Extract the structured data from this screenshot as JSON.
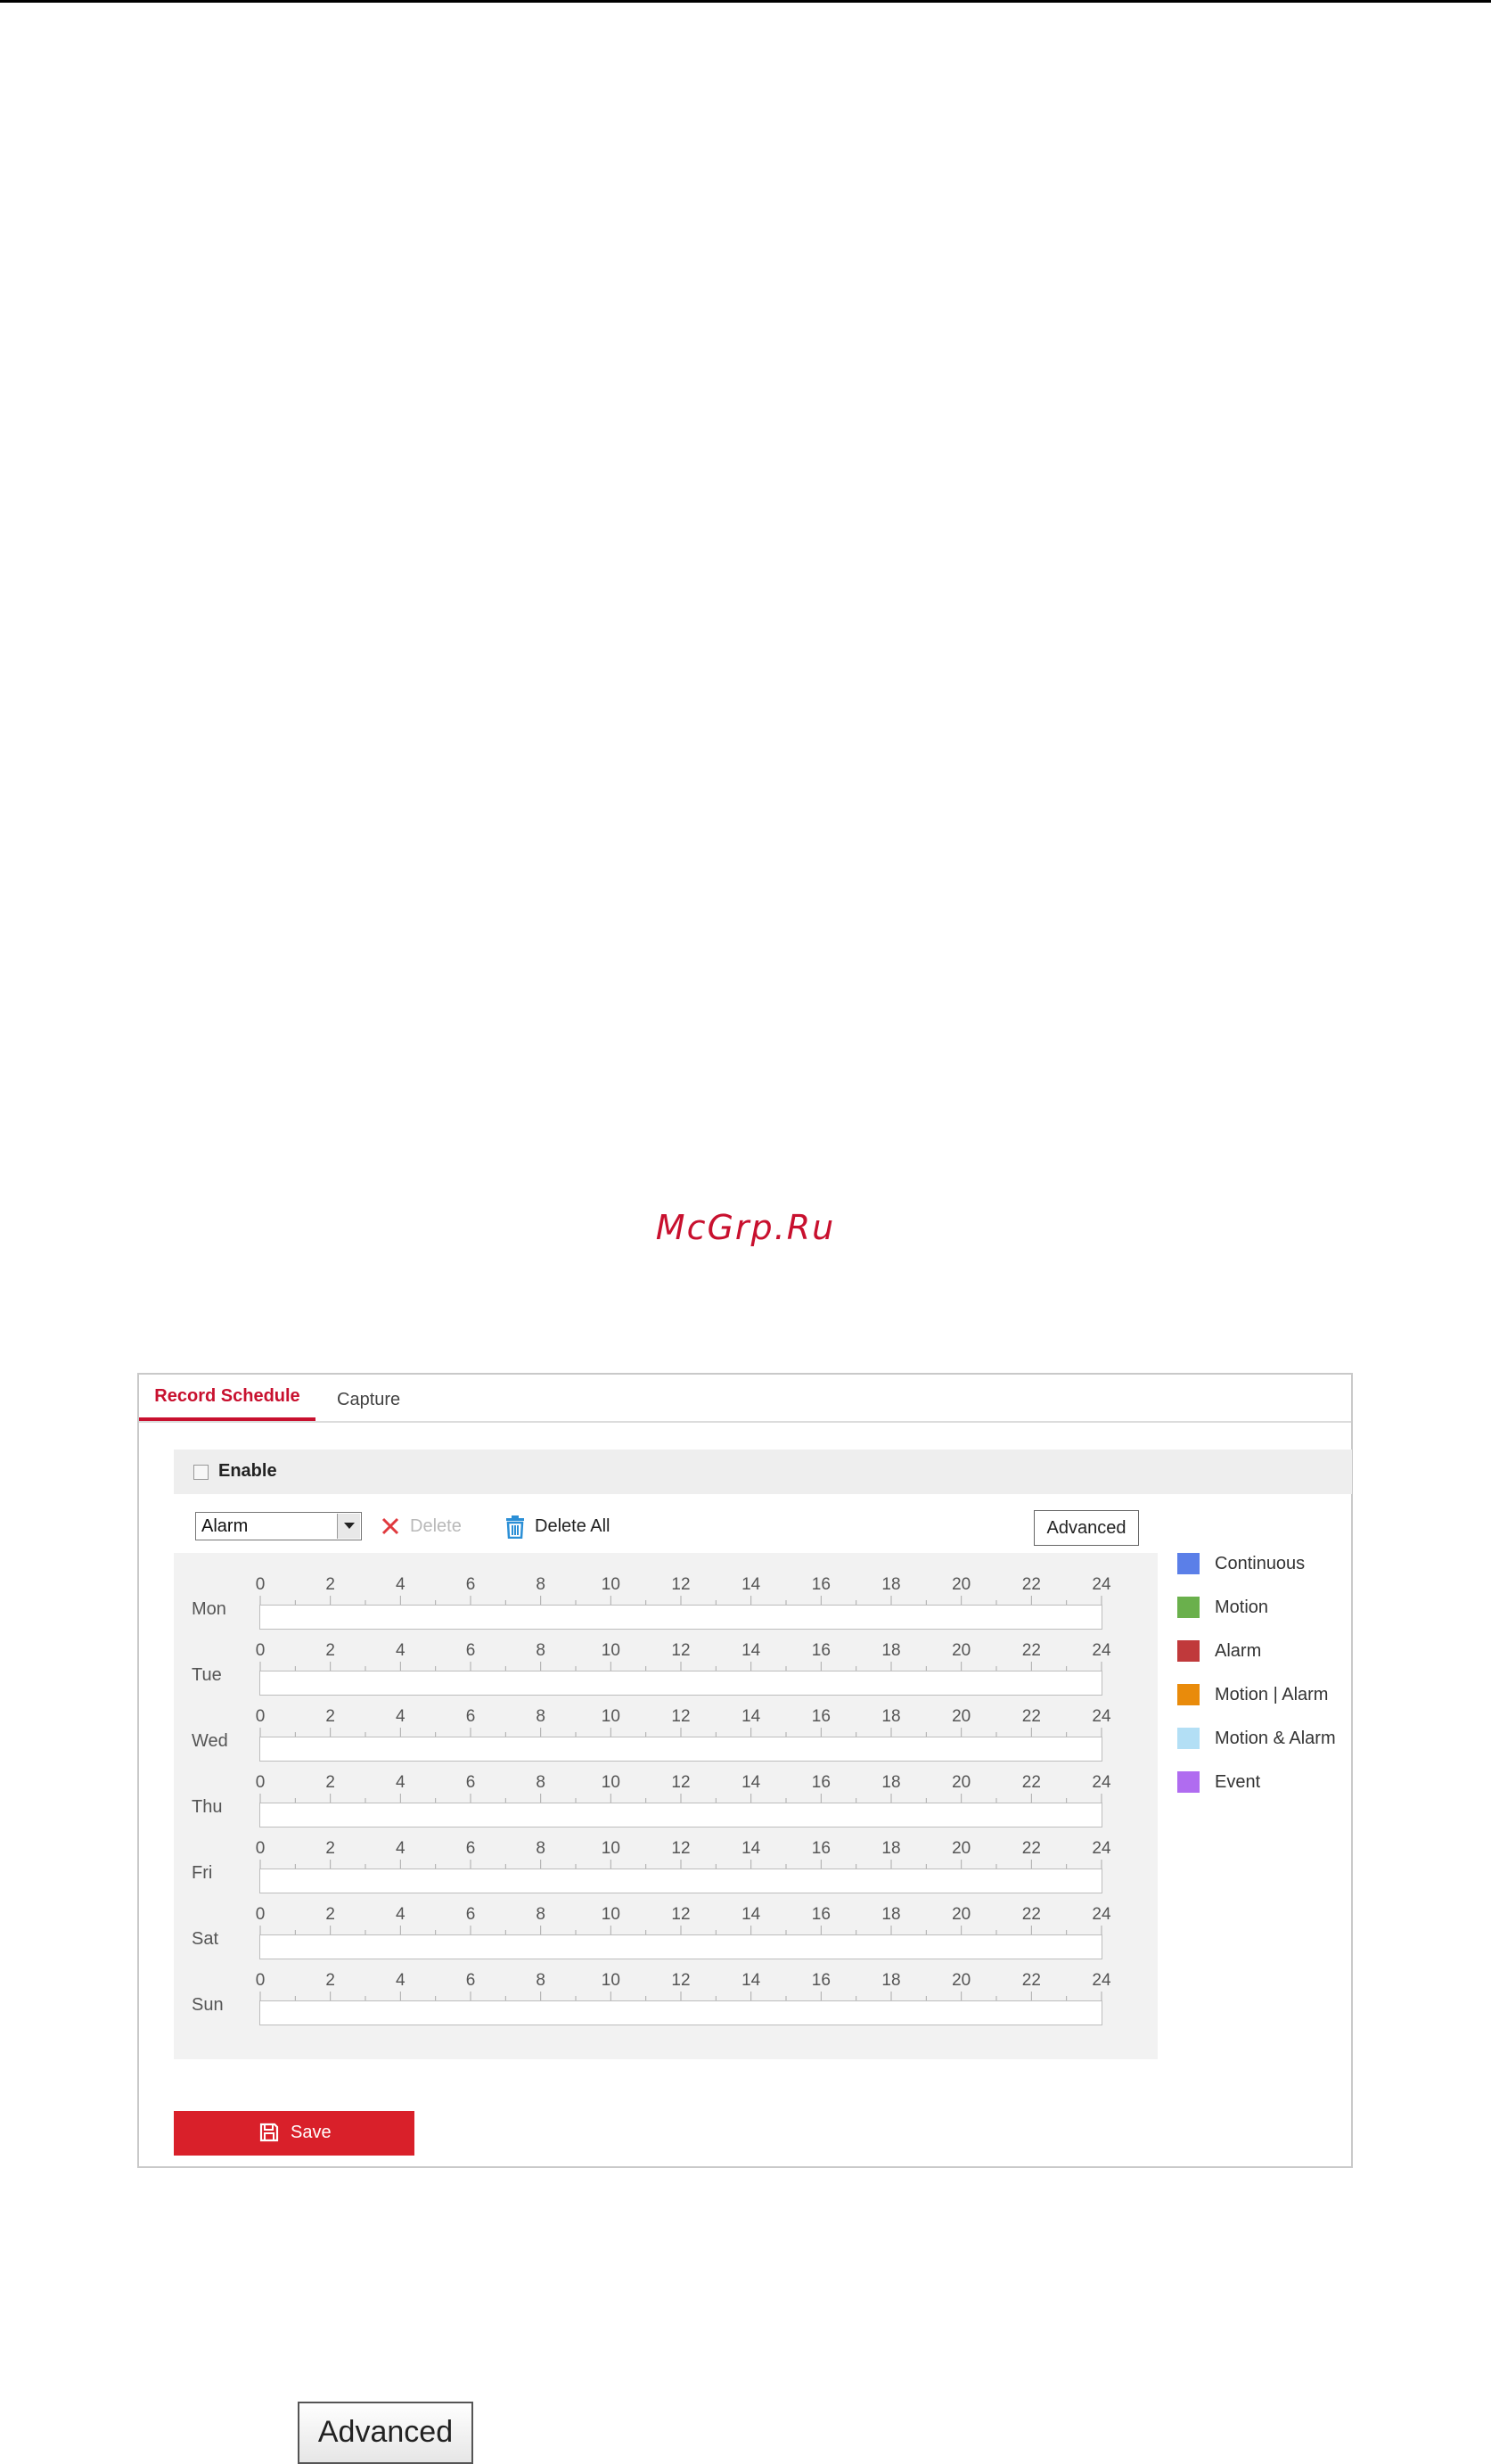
{
  "watermark": "McGrp.Ru",
  "tabs": [
    {
      "label": "Record Schedule",
      "active": true
    },
    {
      "label": "Capture",
      "active": false
    }
  ],
  "enable": {
    "label": "Enable",
    "checked": false
  },
  "toolbar": {
    "record_type": "Alarm",
    "delete_label": "Delete",
    "delete_all_label": "Delete All",
    "advanced_label": "Advanced"
  },
  "schedule": {
    "hour_ticks": [
      "0",
      "2",
      "4",
      "6",
      "8",
      "10",
      "12",
      "14",
      "16",
      "18",
      "20",
      "22",
      "24"
    ],
    "days": [
      "Mon",
      "Tue",
      "Wed",
      "Thu",
      "Fri",
      "Sat",
      "Sun"
    ]
  },
  "legend": [
    {
      "label": "Continuous",
      "color": "#5b7fe8"
    },
    {
      "label": "Motion",
      "color": "#6ab04c"
    },
    {
      "label": "Alarm",
      "color": "#c0393b"
    },
    {
      "label": "Motion | Alarm",
      "color": "#e98b0b"
    },
    {
      "label": "Motion & Alarm",
      "color": "#b3dff5"
    },
    {
      "label": "Event",
      "color": "#b06cf0"
    }
  ],
  "save_label": "Save",
  "colors": {
    "accent": "#c8102e",
    "save_button": "#d9202a",
    "trash_icon": "#2b8fd6"
  },
  "footer_button_label": "Advanced"
}
